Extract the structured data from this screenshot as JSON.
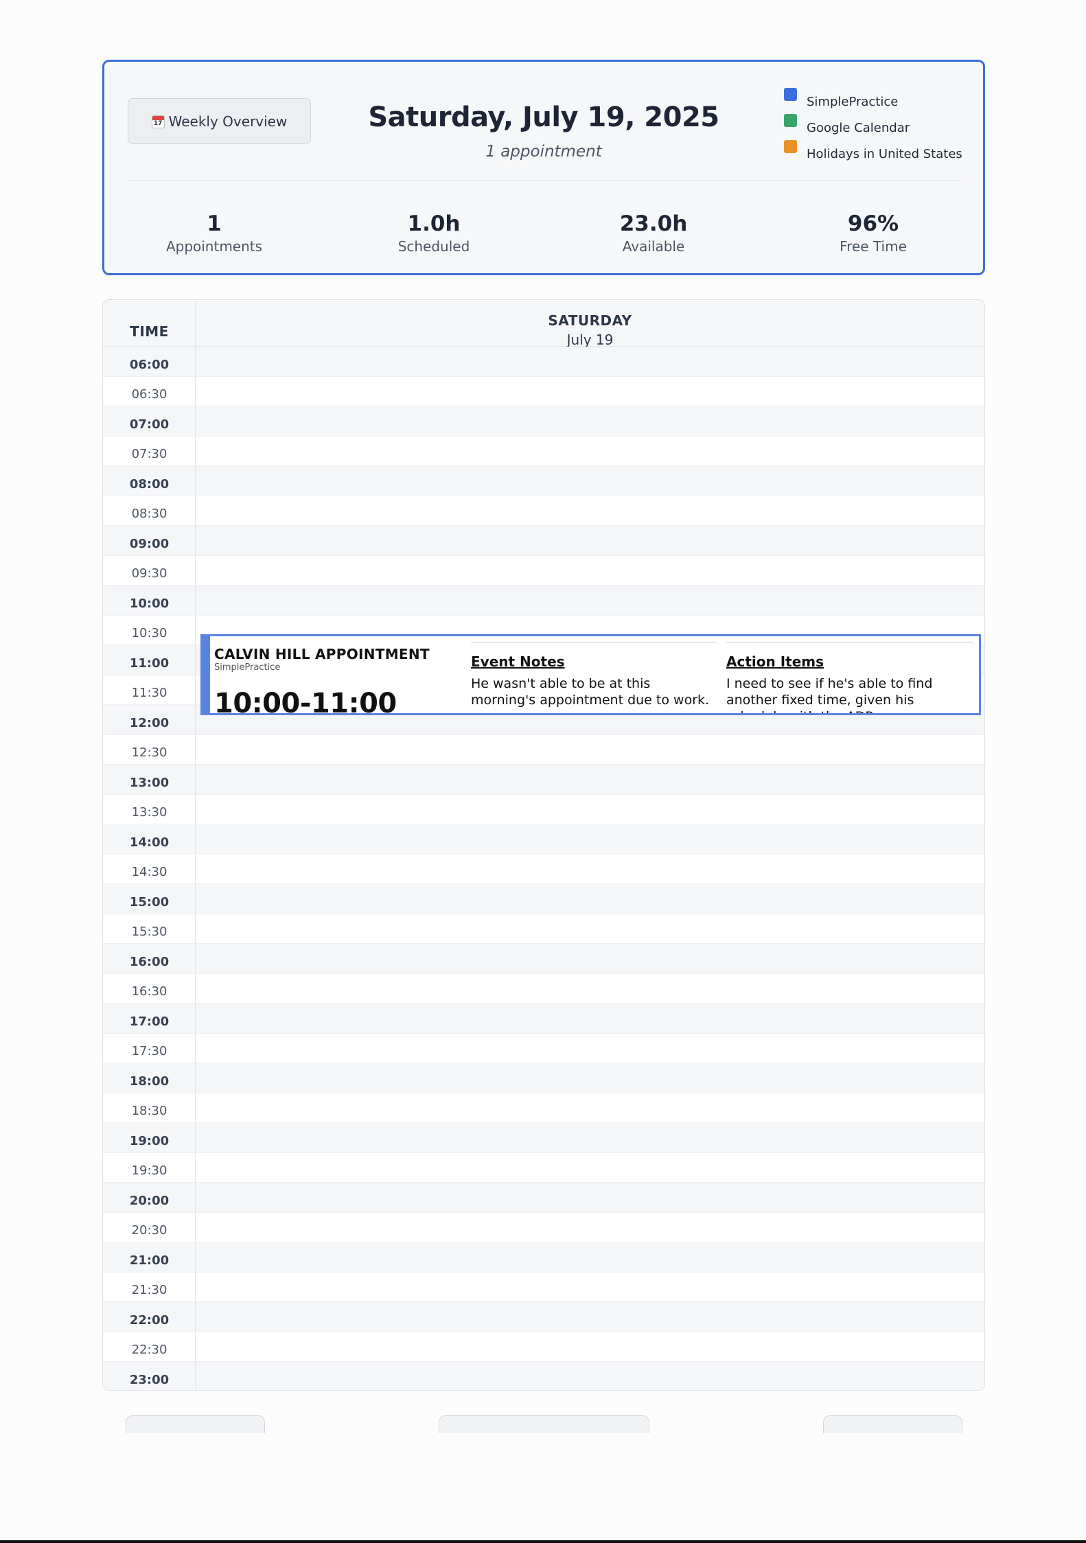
{
  "header": {
    "weekly_button_label": "Weekly Overview",
    "calendar_icon_text": "17",
    "date_title": "Saturday, July 19, 2025",
    "appointment_count_text": "1 appointment"
  },
  "legend": [
    {
      "label": "SimplePractice",
      "color": "#3b6fe0"
    },
    {
      "label": "Google Calendar",
      "color": "#38a46a"
    },
    {
      "label": "Holidays in United States",
      "color": "#e8922a"
    }
  ],
  "stats": [
    {
      "value": "1",
      "label": "Appointments"
    },
    {
      "value": "1.0h",
      "label": "Scheduled"
    },
    {
      "value": "23.0h",
      "label": "Available"
    },
    {
      "value": "96%",
      "label": "Free Time"
    }
  ],
  "calendar": {
    "time_header": "TIME",
    "day_name": "SATURDAY",
    "day_date": "July 19",
    "time_slots": [
      "06:00",
      "06:30",
      "07:00",
      "07:30",
      "08:00",
      "08:30",
      "09:00",
      "09:30",
      "10:00",
      "10:30",
      "11:00",
      "11:30",
      "12:00",
      "12:30",
      "13:00",
      "13:30",
      "14:00",
      "14:30",
      "15:00",
      "15:30",
      "16:00",
      "16:30",
      "17:00",
      "17:30",
      "18:00",
      "18:30",
      "19:00",
      "19:30",
      "20:00",
      "20:30",
      "21:00",
      "21:30",
      "22:00",
      "22:30",
      "23:00"
    ]
  },
  "appointment": {
    "title": "CALVIN HILL APPOINTMENT",
    "source": "SimplePractice",
    "time_range": "10:00-11:00",
    "notes_title": "Event Notes",
    "notes_body": "He wasn't able to be at this morning's appointment due to work.",
    "actions_title": "Action Items",
    "actions_body": "I need to see if he's able to find another fixed time, given his schedule with the ADP"
  }
}
